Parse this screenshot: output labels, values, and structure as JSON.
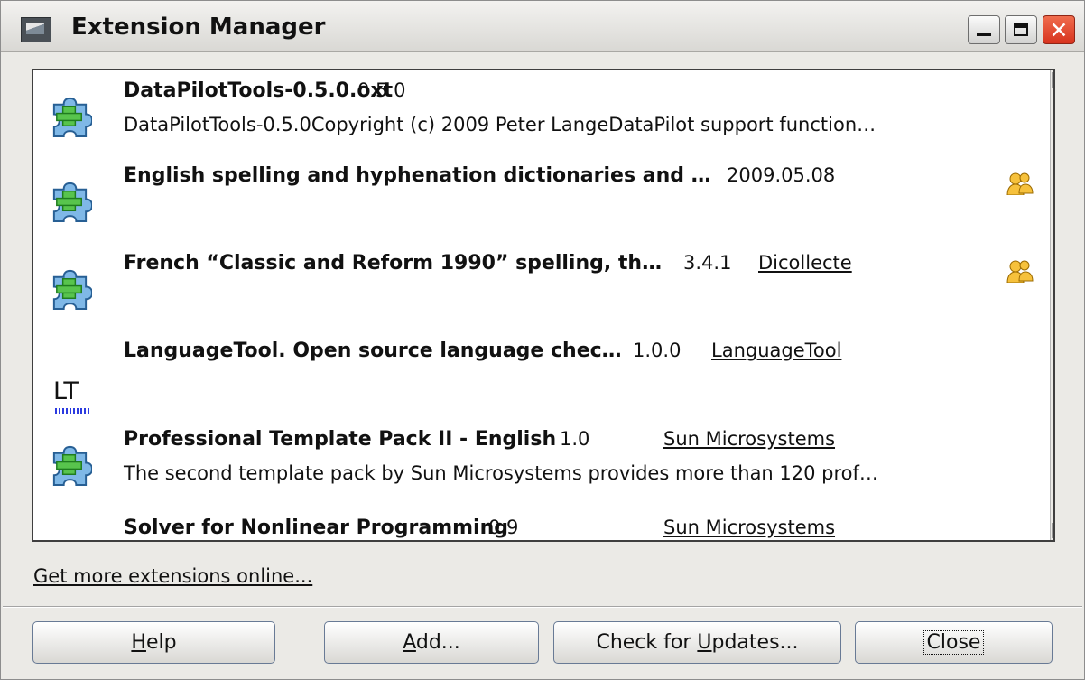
{
  "window": {
    "title": "Extension Manager",
    "min_icon": "minimize-icon",
    "max_icon": "maximize-icon",
    "close_icon": "close-icon"
  },
  "extensions": [
    {
      "name": "DataPilotTools-0.5.0.oxt",
      "version": "0.5.0",
      "publisher": "",
      "description": "DataPilotTools-0.5.0Copyright (c) 2009 Peter LangeDataPilot support function…",
      "icon": "extension-puzzle-icon",
      "shared": false
    },
    {
      "name": "English spelling and hyphenation dictionaries and …",
      "version": "2009.05.08",
      "publisher": "",
      "description": "",
      "icon": "extension-puzzle-icon",
      "shared": true
    },
    {
      "name": "French “Classic and Reform 1990” spelling, th…",
      "version": "3.4.1",
      "publisher": "Dicollecte",
      "description": "",
      "icon": "extension-puzzle-icon",
      "shared": true
    },
    {
      "name": "LanguageTool. Open source language chec…",
      "version": "1.0.0",
      "publisher": "LanguageTool",
      "description": "",
      "icon": "languagetool-icon",
      "icon_text": "LT",
      "shared": false
    },
    {
      "name": "Professional Template Pack II - English",
      "version": "1.0",
      "publisher": "Sun Microsystems",
      "description": "The second template pack by Sun Microsystems provides more than 120 prof…",
      "icon": "extension-puzzle-icon",
      "shared": false
    },
    {
      "name": "Solver for Nonlinear Programming",
      "version": "0.9",
      "publisher": "Sun Microsystems",
      "description": "",
      "icon": "extension-puzzle-icon",
      "shared": false
    }
  ],
  "links": {
    "more_extensions": "Get more extensions online..."
  },
  "buttons": {
    "help": {
      "before": "",
      "mnemonic": "H",
      "after": "elp"
    },
    "add": {
      "before": "",
      "mnemonic": "A",
      "after": "dd..."
    },
    "updates": {
      "before": "Check for ",
      "mnemonic": "U",
      "after": "pdates..."
    },
    "close": "Close"
  },
  "colors": {
    "accent_close": "#d7331e",
    "button_border": "#687a95"
  }
}
